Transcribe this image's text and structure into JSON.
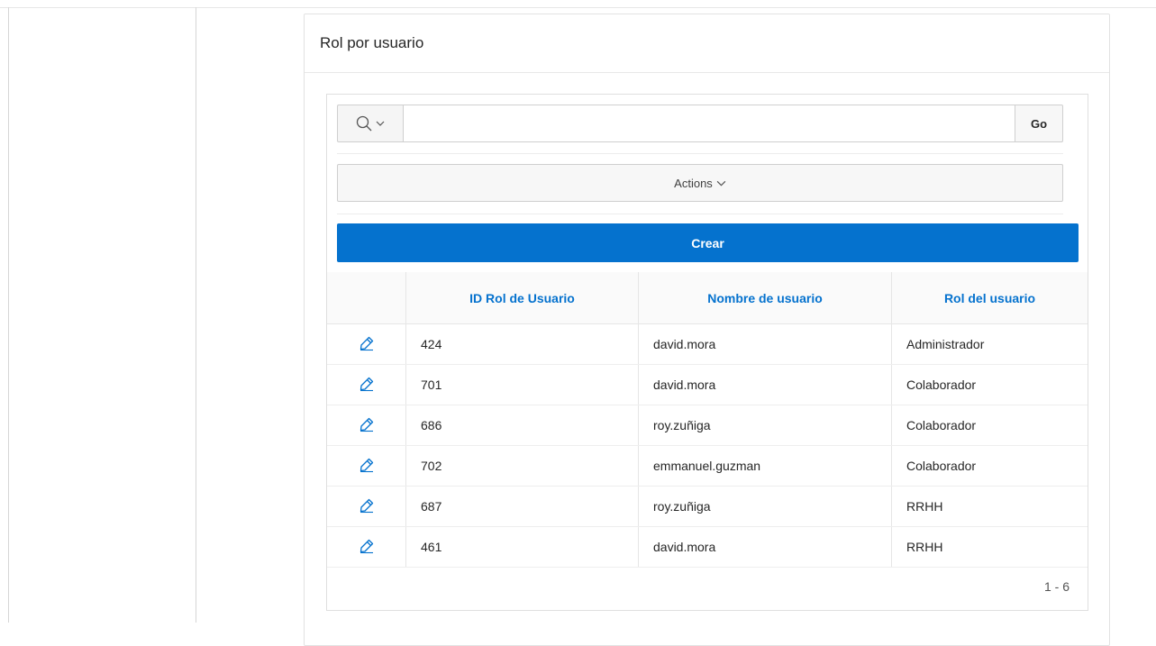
{
  "region": {
    "title": "Rol por usuario"
  },
  "toolbar": {
    "search_value": "",
    "go_label": "Go",
    "actions_label": "Actions",
    "create_label": "Crear"
  },
  "table": {
    "headers": [
      "",
      "ID Rol de Usuario",
      "Nombre de usuario",
      "Rol del usuario"
    ],
    "rows": [
      {
        "id": "424",
        "user": "david.mora",
        "rol": "Administrador"
      },
      {
        "id": "701",
        "user": "david.mora",
        "rol": "Colaborador"
      },
      {
        "id": "686",
        "user": "roy.zuñiga",
        "rol": "Colaborador"
      },
      {
        "id": "702",
        "user": "emmanuel.guzman",
        "rol": "Colaborador"
      },
      {
        "id": "687",
        "user": "roy.zuñiga",
        "rol": "RRHH"
      },
      {
        "id": "461",
        "user": "david.mora",
        "rol": "RRHH"
      }
    ]
  },
  "pagination": {
    "label": "1 - 6"
  },
  "icons": {
    "search": "search-icon",
    "chevron": "chevron-down-icon",
    "edit": "edit-icon"
  },
  "colors": {
    "accent": "#0572ce",
    "header_text": "#0572ce"
  }
}
